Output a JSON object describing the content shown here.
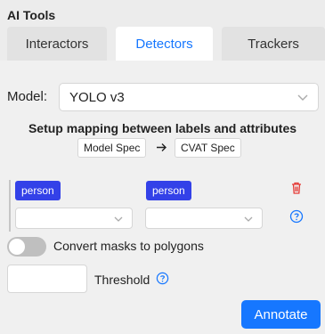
{
  "panel": {
    "title": "AI Tools"
  },
  "tabs": [
    {
      "label": "Interactors",
      "active": false
    },
    {
      "label": "Detectors",
      "active": true
    },
    {
      "label": "Trackers",
      "active": false
    }
  ],
  "model": {
    "label": "Model:",
    "selected": "YOLO v3"
  },
  "mapping": {
    "title": "Setup mapping between labels and attributes",
    "model_spec": "Model Spec",
    "cvat_spec": "CVAT Spec",
    "rows": [
      {
        "model_label": "person",
        "cvat_label": "person"
      }
    ]
  },
  "options": {
    "convert_masks_label": "Convert masks to polygons",
    "convert_masks_enabled": false,
    "threshold_label": "Threshold",
    "threshold_value": ""
  },
  "actions": {
    "annotate_label": "Annotate"
  },
  "colors": {
    "accent": "#1677ff",
    "tag": "#3341e8",
    "delete": "#e53935"
  }
}
